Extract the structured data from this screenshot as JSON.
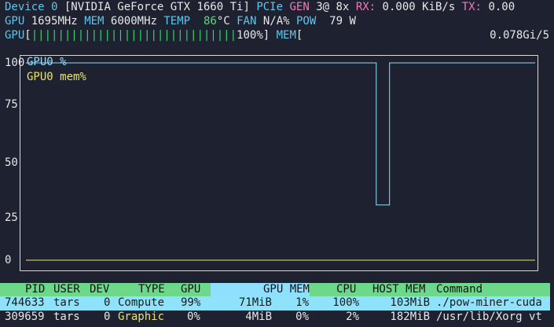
{
  "header": {
    "device_label": "Device 0",
    "device_name": "[NVIDIA GeForce GTX 1660 Ti]",
    "pcie_label": "PCIe",
    "gen_label": "GEN",
    "gen_value": "3@ 8x",
    "rx_label": "RX:",
    "rx_value": "0.000 KiB/s",
    "tx_label": "TX:",
    "tx_value": "0.00",
    "gpu_label": "GPU",
    "gpu_clock": "1695MHz",
    "mem_label": "MEM",
    "mem_clock": "6000MHz",
    "temp_label": "TEMP",
    "temp_value": "86",
    "temp_unit": "°C",
    "fan_label": "FAN",
    "fan_value": "N/A%",
    "pow_label": "POW",
    "pow_value": "79 W"
  },
  "usage": {
    "gpu_label": "GPU",
    "gpu_bar": "|||||||||||||||||||||||||||||||",
    "gpu_percent": "100%",
    "gpu_fraction": 1.0,
    "mem_label": "MEM",
    "mem_value": "0.078Gi/5"
  },
  "chart_data": {
    "type": "line",
    "yticks": [
      "100",
      "75",
      "50",
      "25",
      "0"
    ],
    "ylim": [
      0,
      100
    ],
    "series": [
      {
        "name": "GPU0 %",
        "color": "#8fe0ff",
        "x": [
          0,
          0.688,
          0.688,
          0.714,
          0.714,
          1.0
        ],
        "values": [
          100,
          100,
          28,
          28,
          100,
          100
        ]
      },
      {
        "name": "GPU0 mem%",
        "color": "#e9e36a",
        "x": [
          0,
          1.0
        ],
        "values": [
          0,
          0
        ]
      }
    ]
  },
  "table": {
    "headers": {
      "pid": "PID",
      "user": "USER",
      "dev": "DEV",
      "type": "TYPE",
      "gpu": "GPU",
      "gpu_mem": "GPU MEM",
      "cpu": "CPU",
      "host_mem": "HOST MEM",
      "command": "Command"
    },
    "rows": [
      {
        "pid": "744633",
        "user": "tars",
        "dev": "0",
        "type": "Compute",
        "gpu": "99%",
        "gpu_mem": "71MiB",
        "gpu_mem_pct": "1%",
        "cpu": "100%",
        "host_mem": "103MiB",
        "command": "./pow-miner-cuda"
      },
      {
        "pid": "309659",
        "user": "tars",
        "dev": "0",
        "type": "Graphic",
        "gpu": "0%",
        "gpu_mem": "4MiB",
        "gpu_mem_pct": "0%",
        "cpu": "2%",
        "host_mem": "182MiB",
        "command": "/usr/lib/Xorg vt"
      }
    ]
  }
}
